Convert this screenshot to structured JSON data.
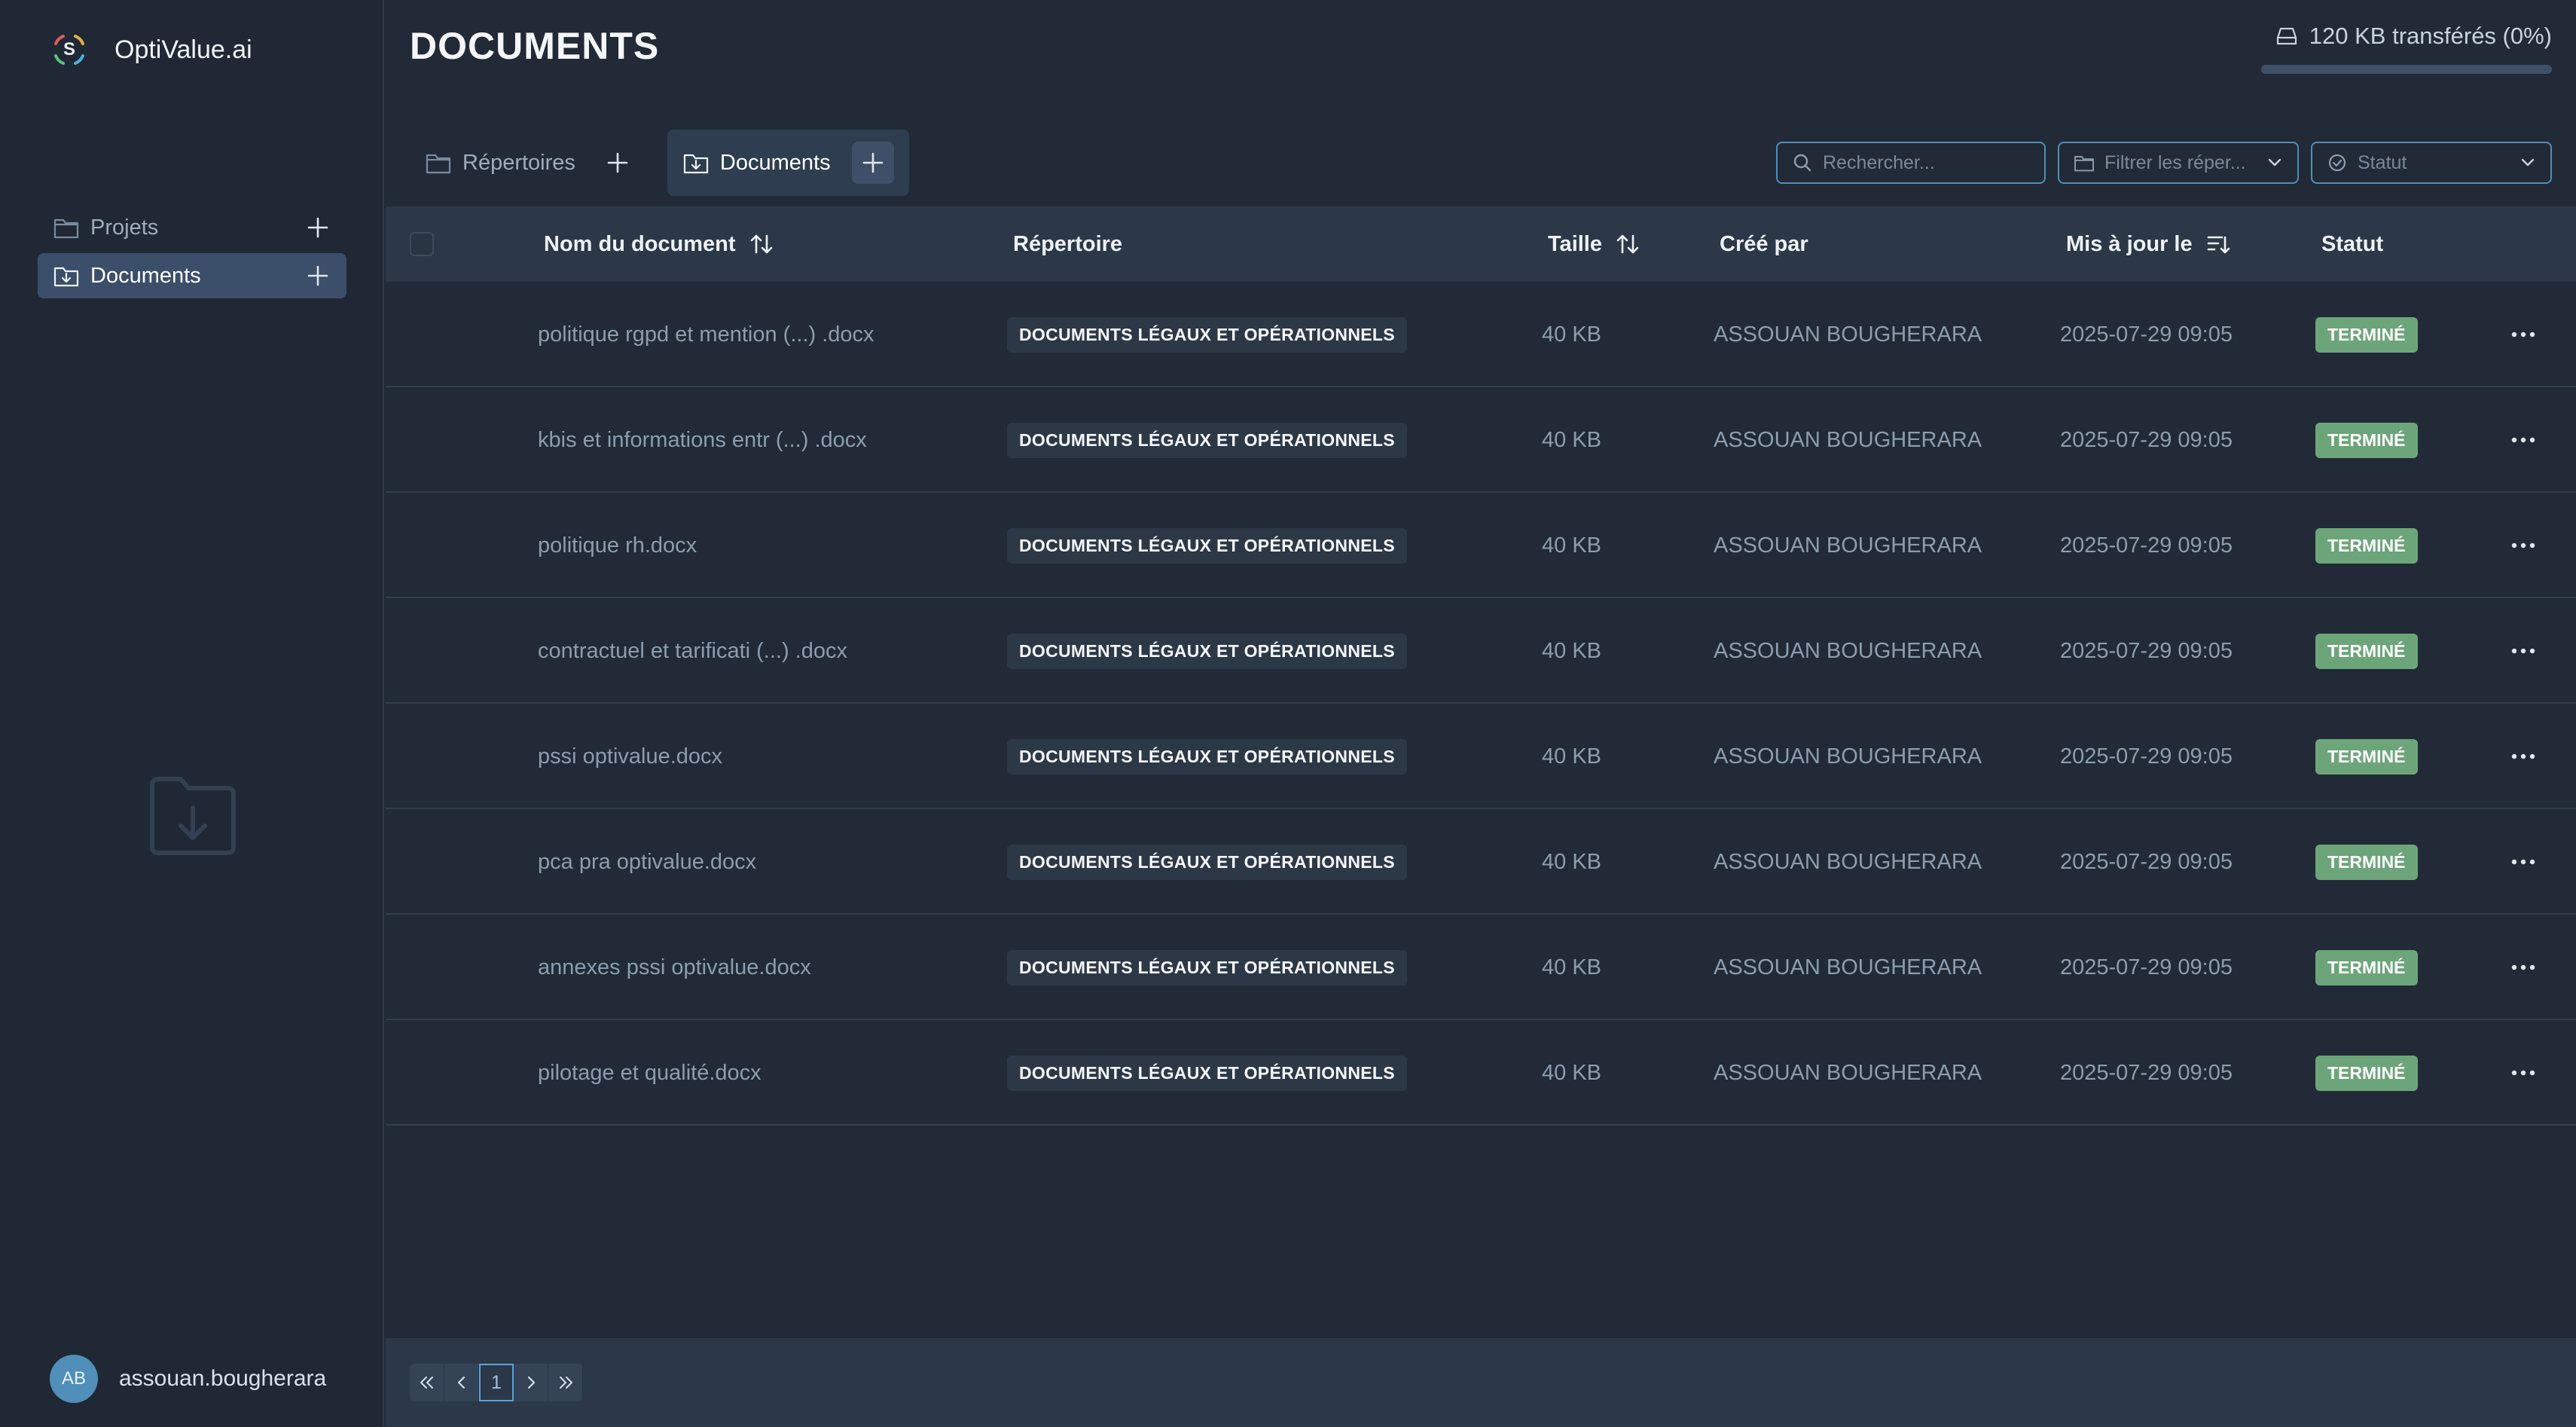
{
  "brand": {
    "name": "OptiValue.ai",
    "logo_letter": "S"
  },
  "sidebar": {
    "items": [
      {
        "label": "Projets",
        "icon": "folder-icon",
        "active": false
      },
      {
        "label": "Documents",
        "icon": "folder-download-icon",
        "active": true
      }
    ],
    "empty_icon": "folder-download-icon"
  },
  "user": {
    "initials": "AB",
    "name": "assouan.bougherara"
  },
  "header": {
    "title": "DOCUMENTS",
    "transfer_text": "120 KB transférés (0%)",
    "transfer_progress": 0
  },
  "tabs": [
    {
      "label": "Répertoires",
      "active": false
    },
    {
      "label": "Documents",
      "active": true
    }
  ],
  "filters": {
    "search_placeholder": "Rechercher...",
    "directory_placeholder": "Filtrer les réper...",
    "status_placeholder": "Statut"
  },
  "table": {
    "columns": {
      "name": "Nom du document",
      "directory": "Répertoire",
      "size": "Taille",
      "created_by": "Créé par",
      "updated": "Mis à jour le",
      "status": "Statut"
    },
    "rows": [
      {
        "name": "politique rgpd et mention (...) .docx",
        "directory": "DOCUMENTS LÉGAUX ET OPÉRATIONNELS",
        "size": "40 KB",
        "created_by": "ASSOUAN BOUGHERARA",
        "updated": "2025-07-29 09:05",
        "status": "TERMINÉ"
      },
      {
        "name": "kbis et informations entr (...) .docx",
        "directory": "DOCUMENTS LÉGAUX ET OPÉRATIONNELS",
        "size": "40 KB",
        "created_by": "ASSOUAN BOUGHERARA",
        "updated": "2025-07-29 09:05",
        "status": "TERMINÉ"
      },
      {
        "name": "politique rh.docx",
        "directory": "DOCUMENTS LÉGAUX ET OPÉRATIONNELS",
        "size": "40 KB",
        "created_by": "ASSOUAN BOUGHERARA",
        "updated": "2025-07-29 09:05",
        "status": "TERMINÉ"
      },
      {
        "name": "contractuel et tarificati (...) .docx",
        "directory": "DOCUMENTS LÉGAUX ET OPÉRATIONNELS",
        "size": "40 KB",
        "created_by": "ASSOUAN BOUGHERARA",
        "updated": "2025-07-29 09:05",
        "status": "TERMINÉ"
      },
      {
        "name": "pssi optivalue.docx",
        "directory": "DOCUMENTS LÉGAUX ET OPÉRATIONNELS",
        "size": "40 KB",
        "created_by": "ASSOUAN BOUGHERARA",
        "updated": "2025-07-29 09:05",
        "status": "TERMINÉ"
      },
      {
        "name": "pca pra optivalue.docx",
        "directory": "DOCUMENTS LÉGAUX ET OPÉRATIONNELS",
        "size": "40 KB",
        "created_by": "ASSOUAN BOUGHERARA",
        "updated": "2025-07-29 09:05",
        "status": "TERMINÉ"
      },
      {
        "name": "annexes pssi optivalue.docx",
        "directory": "DOCUMENTS LÉGAUX ET OPÉRATIONNELS",
        "size": "40 KB",
        "created_by": "ASSOUAN BOUGHERARA",
        "updated": "2025-07-29 09:05",
        "status": "TERMINÉ"
      },
      {
        "name": "pilotage et qualité.docx",
        "directory": "DOCUMENTS LÉGAUX ET OPÉRATIONNELS",
        "size": "40 KB",
        "created_by": "ASSOUAN BOUGHERARA",
        "updated": "2025-07-29 09:05",
        "status": "TERMINÉ"
      }
    ]
  },
  "pagination": {
    "current_page": "1"
  },
  "colors": {
    "background": "#212a36",
    "accent": "#5aa3d6",
    "status_done": "#6da57a"
  }
}
